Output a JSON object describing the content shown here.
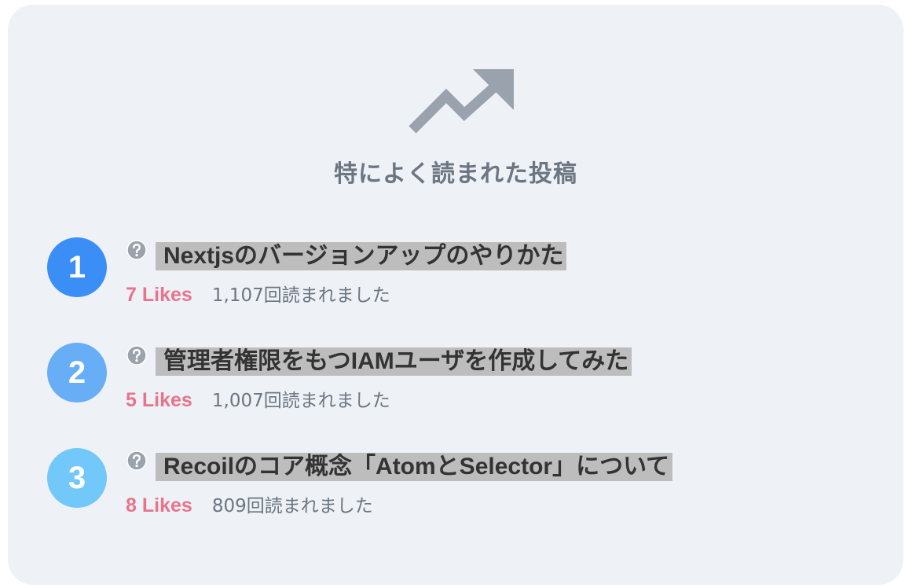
{
  "heading": "特によく読まれた投稿",
  "icons": {
    "header": "trending-up-icon",
    "title_prefix": "question-mark-icon"
  },
  "colors": {
    "card_background": "#eef1f6",
    "icon_gray": "#9aa3ad",
    "heading_text": "#6b7682",
    "likes_text": "#e8748b",
    "title_highlight": "#bdbdbd",
    "rank_1": "#3b8ef5",
    "rank_2": "#67aef7",
    "rank_3": "#72c8f8"
  },
  "posts": [
    {
      "rank": "1",
      "title": "Nextjsのバージョンアップのやりかた",
      "likes": "7 Likes",
      "reads": "1,107回読まれました"
    },
    {
      "rank": "2",
      "title": "管理者権限をもつIAMユーザを作成してみた",
      "likes": "5 Likes",
      "reads": "1,007回読まれました"
    },
    {
      "rank": "3",
      "title": "Recoilのコア概念「AtomとSelector」について",
      "likes": "8 Likes",
      "reads": "809回読まれました"
    }
  ]
}
